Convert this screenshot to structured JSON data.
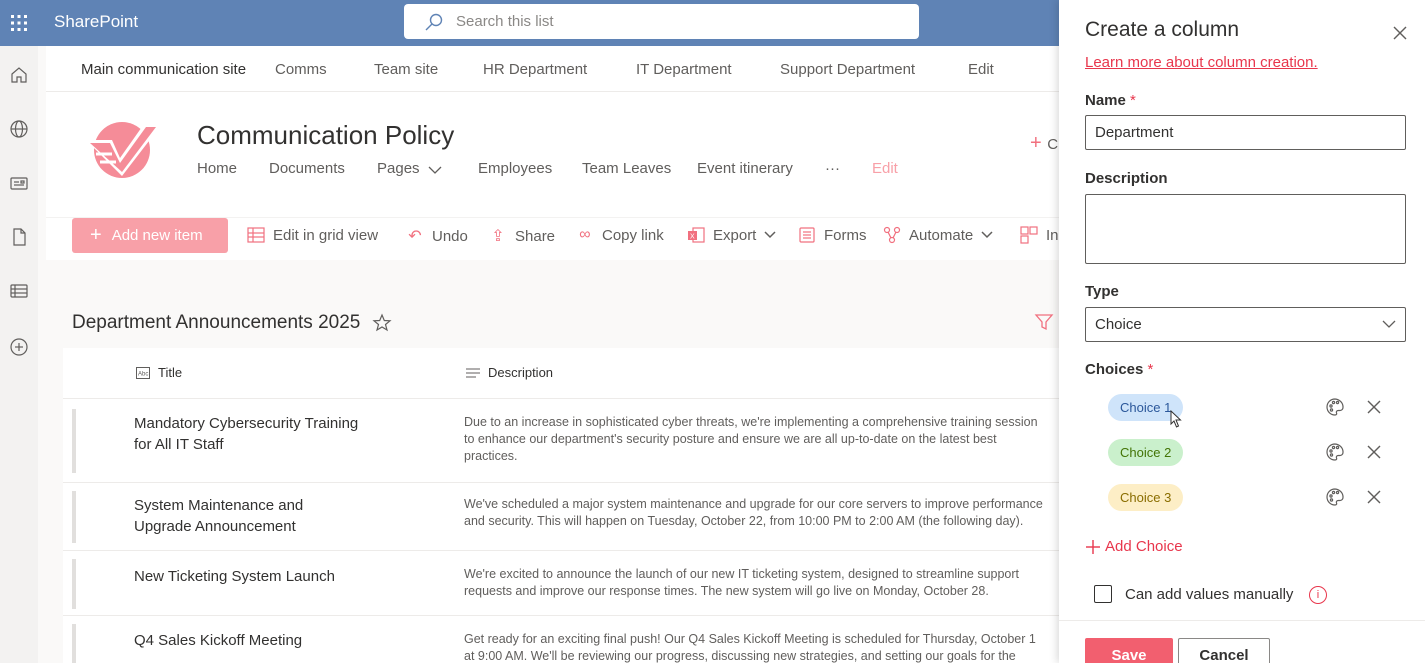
{
  "suite": {
    "brand": "SharePoint",
    "search_placeholder": "Search this list"
  },
  "appbar": {
    "icons": [
      "home-icon",
      "globe-icon",
      "news-icon",
      "document-icon",
      "list-icon",
      "add-icon"
    ]
  },
  "hubnav": {
    "items": [
      "Main communication site",
      "Comms",
      "Team site",
      "HR Department",
      "IT Department",
      "Support Department",
      "Edit"
    ]
  },
  "site": {
    "title": "Communication Policy",
    "nav": [
      "Home",
      "Documents",
      "Pages",
      "Employees",
      "Team Leaves",
      "Event itinerary",
      "···",
      "Edit"
    ],
    "new_label": "C"
  },
  "commands": {
    "add_new_item": "Add new item",
    "edit_grid": "Edit in grid view",
    "undo": "Undo",
    "share": "Share",
    "copy_link": "Copy link",
    "export": "Export",
    "forms": "Forms",
    "automate": "Automate",
    "integrate": "In"
  },
  "list": {
    "title": "Department Announcements 2025",
    "columns": {
      "title": "Title",
      "description": "Description"
    },
    "rows": [
      {
        "title": "Mandatory Cybersecurity Training for All IT Staff",
        "desc_lines": [
          "Due to an increase in sophisticated cyber threats, we're implementing a comprehensive training session",
          "to enhance our department's security posture and ensure we are all up-to-date on the latest best",
          "practices."
        ]
      },
      {
        "title": "System Maintenance and Upgrade Announcement",
        "desc_lines": [
          "We've scheduled a major system maintenance and upgrade for our core servers to improve performance",
          "and security. This will happen on Tuesday, October 22, from 10:00 PM to 2:00 AM (the following day)."
        ]
      },
      {
        "title": "New Ticketing System Launch",
        "desc_lines": [
          "We're excited to announce the launch of our new IT ticketing system, designed to streamline support",
          "requests and improve our response times. The new system will go live on Monday, October 28."
        ]
      },
      {
        "title": "Q4 Sales Kickoff Meeting",
        "desc_lines": [
          "Get ready for an exciting final push! Our Q4 Sales Kickoff Meeting is scheduled for Thursday, October 1",
          "at 9:00 AM. We'll be reviewing our progress, discussing new strategies, and setting our goals for the"
        ]
      }
    ]
  },
  "panel": {
    "title": "Create a column",
    "learn_more": "Learn more about column creation.",
    "name_label": "Name",
    "name_value": "Department",
    "description_label": "Description",
    "description_value": "",
    "type_label": "Type",
    "type_value": "Choice",
    "choices_label": "Choices",
    "required_mark": "*",
    "choices": [
      {
        "label": "Choice 1",
        "bg": "#cfe4fa",
        "fg": "#2b579a"
      },
      {
        "label": "Choice 2",
        "bg": "#caf0cc",
        "fg": "#437406"
      },
      {
        "label": "Choice 3",
        "bg": "#fdeec6",
        "fg": "#8a6d00"
      }
    ],
    "add_choice": "Add Choice",
    "manual_label": "Can add values manually",
    "manual_checked": false,
    "info_icon": "i",
    "save": "Save",
    "cancel": "Cancel"
  },
  "colors": {
    "suitebar": "#5f83b5",
    "accent": "#e8364c",
    "theme_pink": "#f1707f"
  }
}
